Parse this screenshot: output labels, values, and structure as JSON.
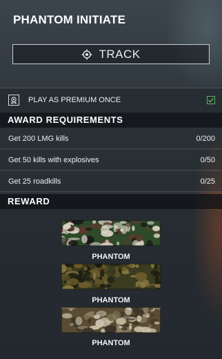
{
  "challenge": {
    "title": "PHANTOM INITIATE",
    "track_label": "TRACK"
  },
  "premium": {
    "label": "PLAY AS PREMIUM ONCE",
    "checked": true
  },
  "requirements": {
    "header": "AWARD REQUIREMENTS",
    "items": [
      {
        "name": "Get 200 LMG kills",
        "progress": "0/200"
      },
      {
        "name": "Get 50 kills with explosives",
        "progress": "0/50"
      },
      {
        "name": "Get 25 roadkills",
        "progress": "0/25"
      }
    ]
  },
  "reward": {
    "header": "REWARD",
    "items": [
      {
        "label": "PHANTOM",
        "palette": [
          "#2f4a29",
          "#5a3a2c",
          "#d8d4c5",
          "#1a1a18"
        ]
      },
      {
        "label": "PHANTOM",
        "palette": [
          "#3a3b1f",
          "#6a5a2a",
          "#8a7c44",
          "#1c1d12"
        ]
      },
      {
        "label": "PHANTOM",
        "palette": [
          "#5a4c34",
          "#c9c1a9",
          "#3a3428",
          "#8c7e5e"
        ]
      }
    ]
  },
  "colors": {
    "accent_check": "#5fb35f",
    "header_bg": "#0e1114"
  }
}
